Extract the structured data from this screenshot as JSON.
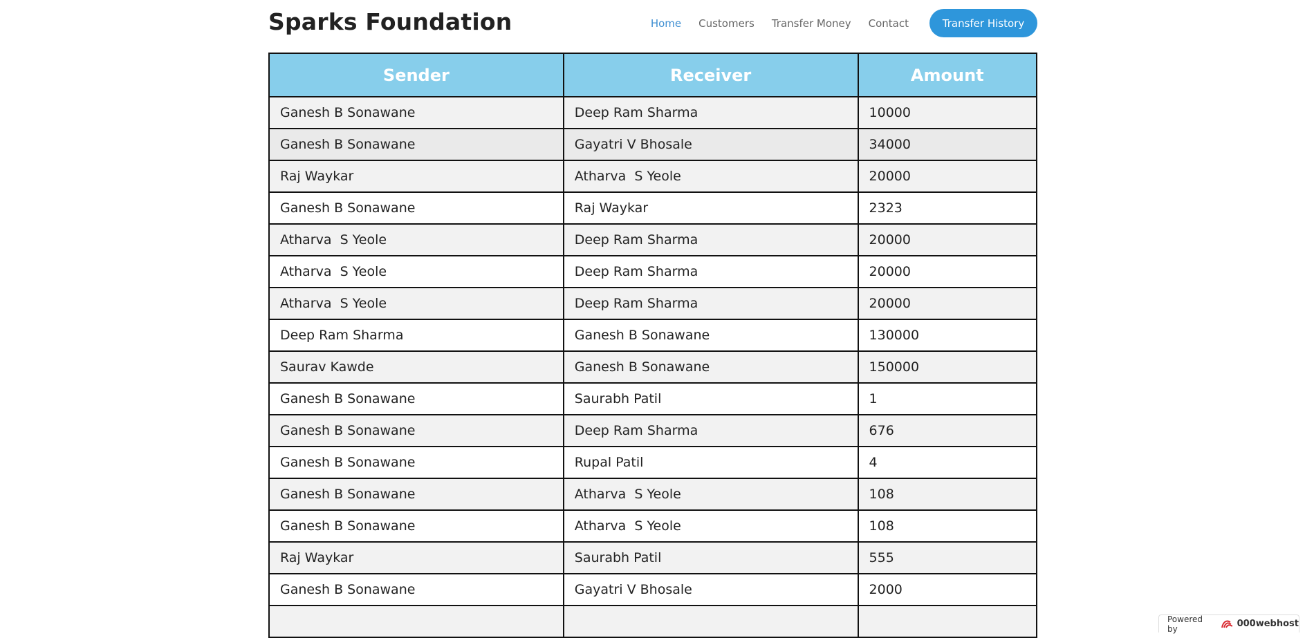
{
  "header": {
    "brand": "Sparks Foundation",
    "nav": [
      {
        "label": "Home"
      },
      {
        "label": "Customers"
      },
      {
        "label": "Transfer Money"
      },
      {
        "label": "Contact"
      }
    ],
    "cta_label": "Transfer History",
    "accent_color": "#2e96db"
  },
  "table": {
    "columns": [
      "Sender",
      "Receiver",
      "Amount"
    ],
    "header_color": "#87ceeb",
    "rows": [
      {
        "sender": "Ganesh B Sonawane",
        "receiver": "Deep Ram Sharma",
        "amount": "10000"
      },
      {
        "sender": "Ganesh B Sonawane",
        "receiver": "Gayatri V Bhosale",
        "amount": "34000"
      },
      {
        "sender": "Raj Waykar",
        "receiver": "Atharva  S Yeole",
        "amount": "20000"
      },
      {
        "sender": "Ganesh B Sonawane",
        "receiver": "Raj Waykar",
        "amount": "2323"
      },
      {
        "sender": "Atharva  S Yeole",
        "receiver": "Deep Ram Sharma",
        "amount": "20000"
      },
      {
        "sender": "Atharva  S Yeole",
        "receiver": "Deep Ram Sharma",
        "amount": "20000"
      },
      {
        "sender": "Atharva  S Yeole",
        "receiver": "Deep Ram Sharma",
        "amount": "20000"
      },
      {
        "sender": "Deep Ram Sharma",
        "receiver": "Ganesh B Sonawane",
        "amount": "130000"
      },
      {
        "sender": "Saurav Kawde",
        "receiver": "Ganesh B Sonawane",
        "amount": "150000"
      },
      {
        "sender": "Ganesh B Sonawane",
        "receiver": "Saurabh Patil",
        "amount": "1"
      },
      {
        "sender": "Ganesh B Sonawane",
        "receiver": "Deep Ram Sharma",
        "amount": "676"
      },
      {
        "sender": "Ganesh B Sonawane",
        "receiver": "Rupal Patil",
        "amount": "4"
      },
      {
        "sender": "Ganesh B Sonawane",
        "receiver": "Atharva  S Yeole",
        "amount": "108"
      },
      {
        "sender": "Ganesh B Sonawane",
        "receiver": "Atharva  S Yeole",
        "amount": "108"
      },
      {
        "sender": "Raj Waykar",
        "receiver": "Saurabh Patil",
        "amount": "555"
      },
      {
        "sender": "Ganesh B Sonawane",
        "receiver": "Gayatri V Bhosale",
        "amount": "2000"
      },
      {
        "sender": "",
        "receiver": "",
        "amount": ""
      }
    ]
  },
  "footer": {
    "powered_label": "Powered by",
    "powered_brand": "000webhost",
    "logo_icon": "000webhost-logo-icon"
  }
}
